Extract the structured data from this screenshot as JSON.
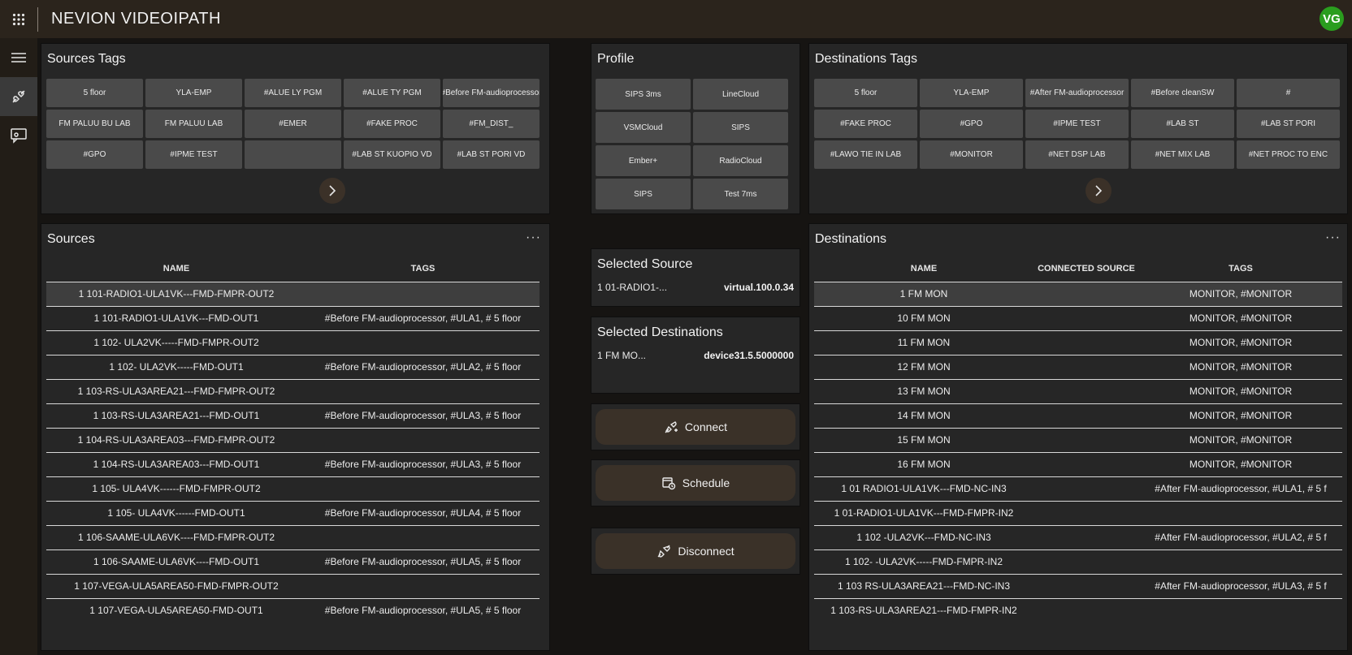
{
  "app": {
    "title": "NEVION VIDEOIPATH",
    "avatar": "VG"
  },
  "sources_tags": {
    "title": "Sources Tags",
    "tags": [
      "5 floor",
      "YLA-EMP",
      "#ALUE LY PGM",
      "#ALUE TY PGM",
      "#Before FM-audioprocessor",
      "FM PALUU BU LAB",
      "FM PALUU LAB",
      "#EMER",
      "#FAKE PROC",
      "#FM_DIST_",
      "#GPO",
      "#IPME TEST",
      "",
      "#LAB ST KUOPIO VD",
      "#LAB ST PORI VD"
    ]
  },
  "profile": {
    "title": "Profile",
    "items": [
      "SIPS 3ms",
      "LineCloud",
      "VSMCloud",
      "SIPS",
      "Ember+",
      "RadioCloud",
      "SIPS",
      "Test 7ms"
    ]
  },
  "destinations_tags": {
    "title": "Destinations Tags",
    "tags": [
      "5 floor",
      "YLA-EMP",
      "#After FM-audioprocessor",
      "#Before cleanSW",
      "#",
      "#FAKE PROC",
      "#GPO",
      "#IPME TEST",
      "#LAB ST",
      "#LAB ST PORI",
      "#LAWO TIE IN LAB",
      "#MONITOR",
      "#NET DSP LAB",
      "#NET MIX LAB",
      "#NET PROC TO ENC"
    ]
  },
  "sources": {
    "title": "Sources",
    "more": "···",
    "columns": [
      "NAME",
      "TAGS"
    ],
    "rows": [
      {
        "name": "1 101-RADIO1-ULA1VK---FMD-FMPR-OUT2",
        "tags": ""
      },
      {
        "name": "1 101-RADIO1-ULA1VK---FMD-OUT1",
        "tags": "#Before FM-audioprocessor, #ULA1, # 5 floor"
      },
      {
        "name": "1 102- ULA2VK-----FMD-FMPR-OUT2",
        "tags": ""
      },
      {
        "name": "1 102- ULA2VK-----FMD-OUT1",
        "tags": "#Before FM-audioprocessor, #ULA2, # 5 floor"
      },
      {
        "name": "1 103-RS-ULA3AREA21---FMD-FMPR-OUT2",
        "tags": ""
      },
      {
        "name": "1 103-RS-ULA3AREA21---FMD-OUT1",
        "tags": "#Before FM-audioprocessor, #ULA3, # 5 floor"
      },
      {
        "name": "1 104-RS-ULA3AREA03---FMD-FMPR-OUT2",
        "tags": ""
      },
      {
        "name": "1 104-RS-ULA3AREA03---FMD-OUT1",
        "tags": "#Before FM-audioprocessor, #ULA3, # 5 floor"
      },
      {
        "name": "1 105- ULA4VK------FMD-FMPR-OUT2",
        "tags": ""
      },
      {
        "name": "1 105- ULA4VK------FMD-OUT1",
        "tags": "#Before FM-audioprocessor, #ULA4, # 5 floor"
      },
      {
        "name": "1 106-SAAME-ULA6VK----FMD-FMPR-OUT2",
        "tags": ""
      },
      {
        "name": "1 106-SAAME-ULA6VK----FMD-OUT1",
        "tags": "#Before FM-audioprocessor, #ULA5, # 5 floor"
      },
      {
        "name": "1 107-VEGA-ULA5AREA50-FMD-FMPR-OUT2",
        "tags": ""
      },
      {
        "name": "1 107-VEGA-ULA5AREA50-FMD-OUT1",
        "tags": "#Before FM-audioprocessor, #ULA5, # 5 floor"
      }
    ]
  },
  "selected_source": {
    "title": "Selected Source",
    "name": "1 01-RADIO1-...",
    "value": "virtual.100.0.34"
  },
  "selected_destinations": {
    "title": "Selected Destinations",
    "name": "1 FM MO...",
    "value": "device31.5.5000000"
  },
  "actions": {
    "connect": "Connect",
    "schedule": "Schedule",
    "disconnect": "Disconnect"
  },
  "destinations": {
    "title": "Destinations",
    "more": "···",
    "columns": [
      "NAME",
      "CONNECTED SOURCE",
      "TAGS"
    ],
    "rows": [
      {
        "name": "1 FM MON",
        "source": "",
        "tags": "MONITOR, #MONITOR"
      },
      {
        "name": "10 FM MON",
        "source": "",
        "tags": "MONITOR, #MONITOR"
      },
      {
        "name": "11 FM MON",
        "source": "",
        "tags": "MONITOR, #MONITOR"
      },
      {
        "name": "12 FM MON",
        "source": "",
        "tags": "MONITOR, #MONITOR"
      },
      {
        "name": "13 FM MON",
        "source": "",
        "tags": "MONITOR, #MONITOR"
      },
      {
        "name": "14 FM MON",
        "source": "",
        "tags": "MONITOR, #MONITOR"
      },
      {
        "name": "15 FM MON",
        "source": "",
        "tags": "MONITOR, #MONITOR"
      },
      {
        "name": "16 FM MON",
        "source": "",
        "tags": "MONITOR, #MONITOR"
      },
      {
        "name": "1 01 RADIO1-ULA1VK---FMD-NC-IN3",
        "source": "",
        "tags": "#After FM-audioprocessor, #ULA1, # 5 f"
      },
      {
        "name": "1 01-RADIO1-ULA1VK---FMD-FMPR-IN2",
        "source": "",
        "tags": ""
      },
      {
        "name": "1 102 -ULA2VK---FMD-NC-IN3",
        "source": "",
        "tags": "#After FM-audioprocessor, #ULA2, # 5 f"
      },
      {
        "name": "1 102- -ULA2VK-----FMD-FMPR-IN2",
        "source": "",
        "tags": ""
      },
      {
        "name": "1 103 RS-ULA3AREA21---FMD-NC-IN3",
        "source": "",
        "tags": "#After FM-audioprocessor, #ULA3, # 5 f"
      },
      {
        "name": "1 103-RS-ULA3AREA21---FMD-FMPR-IN2",
        "source": "",
        "tags": ""
      }
    ]
  }
}
